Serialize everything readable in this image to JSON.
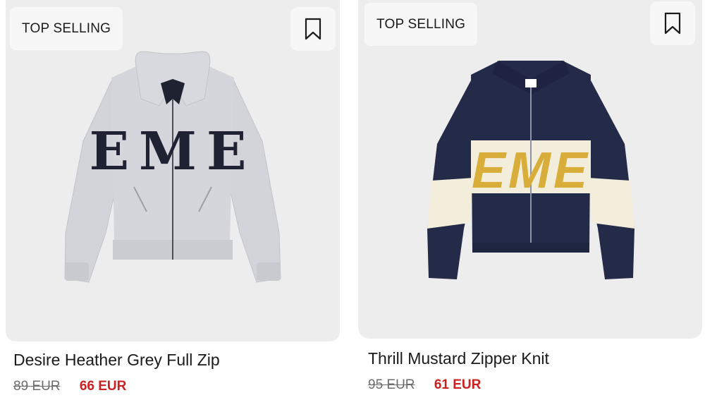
{
  "products": [
    {
      "badge": "TOP SELLING",
      "title": "Desire Heather Grey Full Zip",
      "old_price": "89 EUR",
      "new_price": "66 EUR",
      "logo_text": "EME",
      "image": "grey-zip-hoodie"
    },
    {
      "badge": "TOP SELLING",
      "title": "Thrill Mustard Zipper Knit",
      "old_price": "95 EUR",
      "new_price": "61 EUR",
      "logo_text": "EME",
      "image": "navy-mustard-knit-jacket"
    }
  ],
  "icons": {
    "bookmark": "bookmark-icon"
  },
  "colors": {
    "sale_price": "#cc1f1f",
    "card_background": "#ededee",
    "hoodie_grey": "#d3d4d9",
    "knit_navy": "#242b48",
    "knit_cream": "#f3eedb",
    "knit_mustard": "#d9ad3a"
  }
}
